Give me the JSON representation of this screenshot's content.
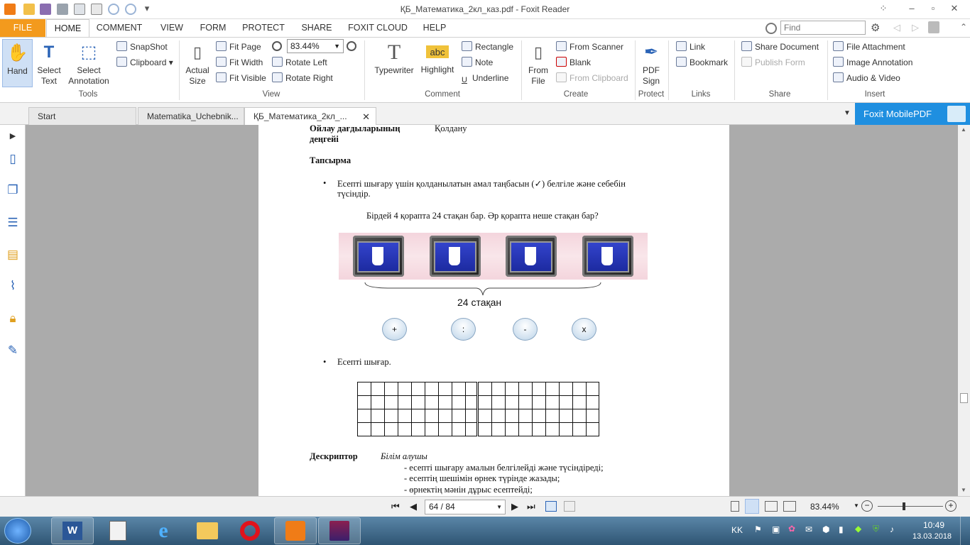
{
  "window": {
    "title": "ҚБ_Математика_2кл_каз.pdf - Foxit Reader"
  },
  "ribbon_tabs": [
    "FILE",
    "HOME",
    "COMMENT",
    "VIEW",
    "FORM",
    "PROTECT",
    "SHARE",
    "FOXIT CLOUD",
    "HELP"
  ],
  "search": {
    "placeholder": "Find"
  },
  "ribbon": {
    "tools": {
      "hand": "Hand",
      "select_text": [
        "Select",
        "Text"
      ],
      "select_annotation": [
        "Select",
        "Annotation"
      ],
      "snapshot": "SnapShot",
      "clipboard": "Clipboard",
      "label": "Tools"
    },
    "view": {
      "actual_size": [
        "Actual",
        "Size"
      ],
      "fit_page": "Fit Page",
      "fit_width": "Fit Width",
      "fit_visible": "Fit Visible",
      "zoom": "83.44%",
      "rotate_left": "Rotate Left",
      "rotate_right": "Rotate Right",
      "label": "View"
    },
    "comment": {
      "typewriter": "Typewriter",
      "highlight": "Highlight",
      "rectangle": "Rectangle",
      "note": "Note",
      "underline": "Underline",
      "label": "Comment"
    },
    "create": {
      "from_file": [
        "From",
        "File"
      ],
      "from_scanner": "From Scanner",
      "blank": "Blank",
      "from_clipboard": "From Clipboard",
      "label": "Create"
    },
    "protect": {
      "pdf_sign": [
        "PDF",
        "Sign"
      ],
      "label": "Protect"
    },
    "links": {
      "link": "Link",
      "bookmark": "Bookmark",
      "label": "Links"
    },
    "share": {
      "share_document": "Share Document",
      "publish_form": "Publish Form",
      "label": "Share"
    },
    "insert": {
      "file_attachment": "File Attachment",
      "image_annotation": "Image Annotation",
      "audio_video": "Audio & Video",
      "label": "Insert"
    }
  },
  "doc_tabs": [
    "Start",
    "Matematika_Uchebnik...",
    "ҚБ_Математика_2кл_..."
  ],
  "mobile_banner": "Foxit MobilePDF",
  "document": {
    "level_label_1": "Ойлау дағдыларының",
    "level_label_2": "деңгейі",
    "level_value": "Қолдану",
    "task_heading": "Тапсырма",
    "bullet1_line1": "Есепті  шығару үшін  қолданылатын амал таңбасын (✓) белгіле және себебін",
    "bullet1_line2": "түсіндір.",
    "problem": "Бірдей  4 қорапта  24 стақан бар.  Әр қорапта неше стақан бар?",
    "brace_label": "24 стақан",
    "operators": [
      "+",
      ":",
      "-",
      "x"
    ],
    "bullet2": "Есепті шығар.",
    "descriptor_label": "Дескриптор",
    "descriptor_sub": "Білім алушы",
    "descriptor_items": [
      "- есепті шығару амалын белгілейді және түсіндіреді;",
      "- есептің шешімін өрнек түрінде жазады;",
      "- өрнектің  мәнін дұрыс есептейді;"
    ]
  },
  "status": {
    "page": "64 / 84",
    "zoom": "83.44%"
  },
  "clock": {
    "time": "10:49",
    "date": "13.03.2018"
  },
  "tray": {
    "lang": "KK"
  },
  "colors": {
    "accent": "#f39a1d",
    "mobile": "#1f8fe0"
  }
}
